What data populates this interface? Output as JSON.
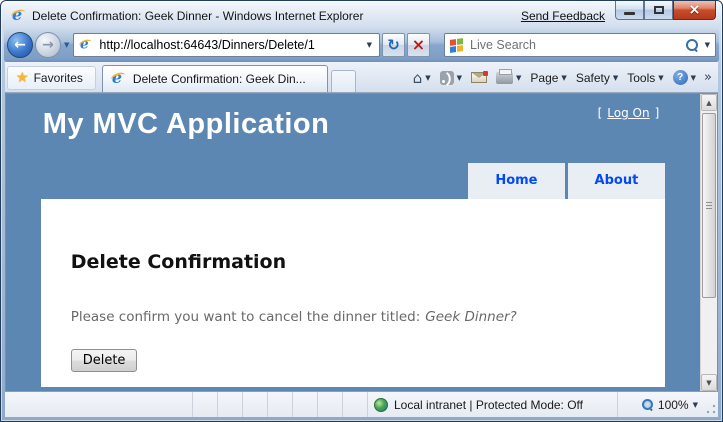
{
  "window": {
    "title": "Delete Confirmation: Geek Dinner - Windows Internet Explorer",
    "send_feedback_label": "Send Feedback"
  },
  "icons": {
    "ie_logo_letter": "e",
    "back_arrow": "←",
    "forward_arrow": "→",
    "dropdown_caret": "▼",
    "refresh": "↻",
    "stop": "×",
    "close": "×",
    "favorites_star": "★",
    "home": "⌂",
    "help": "?",
    "overflow_chevron": "»",
    "scroll_up": "▲",
    "scroll_down": "▼"
  },
  "navigation": {
    "url": "http://localhost:64643/Dinners/Delete/1",
    "search_placeholder": "Live Search"
  },
  "tab_bar": {
    "favorites_label": "Favorites",
    "active_tab_title": "Delete Confirmation: Geek Din...",
    "page_label": "Page",
    "safety_label": "Safety",
    "tools_label": "Tools"
  },
  "content": {
    "site_title": "My MVC Application",
    "logon_prefix": "[",
    "logon_link": "Log On",
    "logon_suffix": "]",
    "menu": [
      "Home",
      "About"
    ],
    "heading": "Delete Confirmation",
    "confirm_text": "Please confirm you want to cancel the dinner titled:",
    "dinner_title": "Geek Dinner?",
    "delete_button_label": "Delete"
  },
  "status_bar": {
    "zone_text": "Local intranet | Protected Mode: Off",
    "zoom_level": "100%"
  },
  "colors": {
    "page_background": "#5c87b2",
    "menu_link": "#034af3",
    "menu_background": "#e8eef4",
    "body_text": "#696969",
    "close_button": "#b53a1c"
  }
}
